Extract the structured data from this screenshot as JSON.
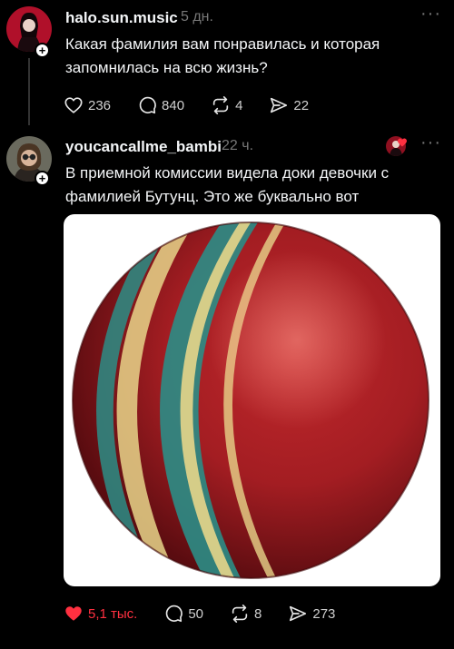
{
  "post1": {
    "username": "halo.sun.music",
    "time": "5 дн.",
    "text_line1": "Какая фамилия вам понравилась и которая",
    "text_line2": "запомнилась на всю жизнь?",
    "likes": "236",
    "comments": "840",
    "reposts": "4",
    "shares": "22"
  },
  "post2": {
    "username": "youcancallme_bambi",
    "time": "22 ч.",
    "text_line1": "В приемной комиссии видела доки девочки с",
    "text_line2": "фамилией Бутунц. Это же буквально вот",
    "likes": "5,1 тыс.",
    "comments": "50",
    "reposts": "8",
    "shares": "273"
  },
  "more_label": "···",
  "colors": {
    "accent_like": "#ff3040",
    "muted": "#777777",
    "background": "#000000"
  }
}
